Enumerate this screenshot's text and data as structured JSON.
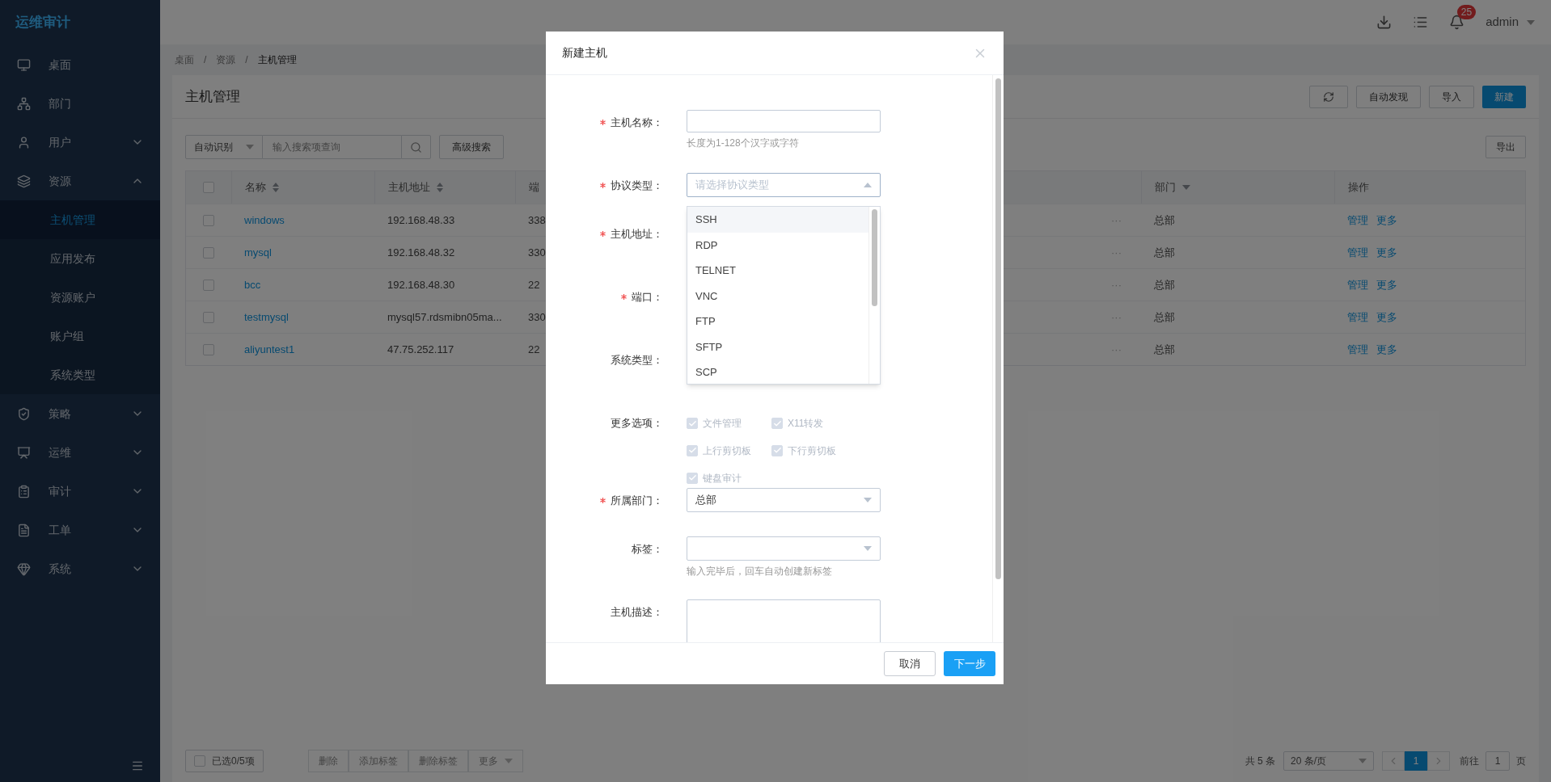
{
  "brand": "运维审计",
  "sidebar": {
    "items": [
      {
        "label": "桌面",
        "kind": "link"
      },
      {
        "label": "部门",
        "kind": "link"
      },
      {
        "label": "用户",
        "kind": "group",
        "expanded": false
      },
      {
        "label": "资源",
        "kind": "group",
        "expanded": true,
        "children": [
          {
            "label": "主机管理",
            "selected": true
          },
          {
            "label": "应用发布",
            "selected": false
          },
          {
            "label": "资源账户",
            "selected": false
          },
          {
            "label": "账户组",
            "selected": false
          },
          {
            "label": "系统类型",
            "selected": false
          }
        ]
      },
      {
        "label": "策略",
        "kind": "group",
        "expanded": false
      },
      {
        "label": "运维",
        "kind": "group",
        "expanded": false
      },
      {
        "label": "审计",
        "kind": "group",
        "expanded": false
      },
      {
        "label": "工单",
        "kind": "group",
        "expanded": false
      },
      {
        "label": "系统",
        "kind": "group",
        "expanded": false
      }
    ]
  },
  "header": {
    "notification_count": "25",
    "user": "admin"
  },
  "breadcrumb": [
    {
      "label": "桌面"
    },
    {
      "separator": "/",
      "label": "资源"
    },
    {
      "separator": "/",
      "label": "主机管理"
    }
  ],
  "page": {
    "title": "主机管理",
    "actions": [
      "自动发现",
      "导入"
    ],
    "primary_action": "新建",
    "search": {
      "scope": "自动识别",
      "placeholder": "输入搜索项查询"
    },
    "advanced_search": "高级搜索",
    "export": "导出"
  },
  "table": {
    "select_all": {
      "checked": false
    },
    "columns": [
      {
        "label": "名称",
        "kind": "sort"
      },
      {
        "label": "主机地址",
        "kind": "sort"
      },
      {
        "label": "端",
        "kind": "plain"
      },
      {
        "label": "部门",
        "kind": "filter"
      },
      {
        "label": "操作",
        "kind": "plain"
      }
    ],
    "rows": [
      {
        "checked": false,
        "name": "windows",
        "address": "192.168.48.33",
        "port": "338",
        "more": "···",
        "department": "总部",
        "actions": [
          "管理",
          "更多"
        ]
      },
      {
        "checked": false,
        "name": "mysql",
        "address": "192.168.48.32",
        "port": "330",
        "more": "···",
        "department": "总部",
        "actions": [
          "管理",
          "更多"
        ]
      },
      {
        "checked": false,
        "name": "bcc",
        "address": "192.168.48.30",
        "port": "22",
        "more": "···",
        "department": "总部",
        "actions": [
          "管理",
          "更多"
        ]
      },
      {
        "checked": false,
        "name": "testmysql",
        "address": "mysql57.rdsmibn05ma...",
        "port": "330",
        "more": "···",
        "department": "总部",
        "actions": [
          "管理",
          "更多"
        ]
      },
      {
        "checked": false,
        "name": "aliyuntest1",
        "address": "47.75.252.117",
        "port": "22",
        "more": "···",
        "department": "总部",
        "actions": [
          "管理",
          "更多"
        ]
      }
    ]
  },
  "footer": {
    "selection": {
      "label": "已选0/5项",
      "checked": false
    },
    "batch_actions": [
      {
        "label": "删除",
        "disabled": true
      },
      {
        "label": "添加标签",
        "disabled": true
      },
      {
        "label": "删除标签",
        "disabled": true
      },
      {
        "label": "更多",
        "disabled": true
      }
    ],
    "total": "共 5 条",
    "page_size": "20 条/页",
    "pages": [
      {
        "label": "1",
        "selected": true
      }
    ],
    "goto_label": "前往",
    "goto_value": "1",
    "goto_unit": "页"
  },
  "modal": {
    "title": "新建主机",
    "fields": [
      {
        "kind": "text",
        "label": "主机名称：",
        "required": true,
        "hint": "长度为1-128个汉字或字符"
      },
      {
        "kind": "select",
        "label": "协议类型：",
        "required": true,
        "placeholder": "请选择协议类型",
        "open": true,
        "options": [
          {
            "label": "SSH",
            "highlighted": true
          },
          {
            "label": "RDP",
            "highlighted": false
          },
          {
            "label": "TELNET",
            "highlighted": false
          },
          {
            "label": "VNC",
            "highlighted": false
          },
          {
            "label": "FTP",
            "highlighted": false
          },
          {
            "label": "SFTP",
            "highlighted": false
          },
          {
            "label": "SCP",
            "highlighted": false
          }
        ]
      },
      {
        "kind": "covered",
        "label": "主机地址：",
        "required": true
      },
      {
        "kind": "covered",
        "label": "端口：",
        "required": true
      },
      {
        "kind": "covered",
        "label": "系统类型：",
        "required": false
      },
      {
        "kind": "options",
        "label": "更多选项：",
        "required": false,
        "options": [
          {
            "label": "文件管理",
            "checked": true,
            "disabled": true
          },
          {
            "label": "X11转发",
            "checked": true,
            "disabled": true
          },
          {
            "label": "上行剪切板",
            "checked": true,
            "disabled": true
          },
          {
            "label": "下行剪切板",
            "checked": true,
            "disabled": true
          },
          {
            "label": "键盘审计",
            "checked": true,
            "disabled": true
          }
        ]
      },
      {
        "kind": "select",
        "label": "所属部门：",
        "required": true,
        "value": "总部",
        "open": false
      },
      {
        "kind": "select",
        "label": "标签：",
        "required": false,
        "open": false,
        "hint": "输入完毕后，回车自动创建新标签"
      },
      {
        "kind": "textarea",
        "label": "主机描述：",
        "required": false
      }
    ],
    "cancel": "取消",
    "next": "下一步"
  }
}
